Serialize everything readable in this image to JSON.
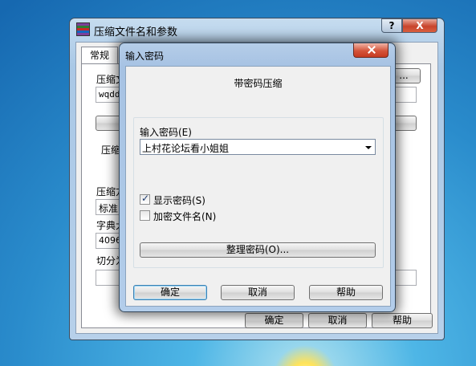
{
  "background_window": {
    "title": "压缩文件名和参数",
    "help_button": "?",
    "close_button": "X",
    "tab_general": "常规",
    "label_archive": "压缩文",
    "archive_value": "wqdd",
    "label_format": "压缩",
    "label_method": "压缩方",
    "method_value": "标准",
    "label_dict": "字典大",
    "dict_value": "4096",
    "label_split": "切分为",
    "browse_button": "...",
    "ok_button": "确定",
    "cancel_button": "取消",
    "help_label": "帮助"
  },
  "dialog": {
    "title": "输入密码",
    "heading": "带密码压缩",
    "password_label": "输入密码(E)",
    "password_value": "上村花论坛看小姐姐",
    "show_password_label": "显示密码(S)",
    "show_password_checked": true,
    "encrypt_filenames_label": "加密文件名(N)",
    "encrypt_filenames_checked": false,
    "manage_button": "整理密码(O)...",
    "ok_button": "确定",
    "cancel_button": "取消",
    "help_button": "帮助"
  }
}
